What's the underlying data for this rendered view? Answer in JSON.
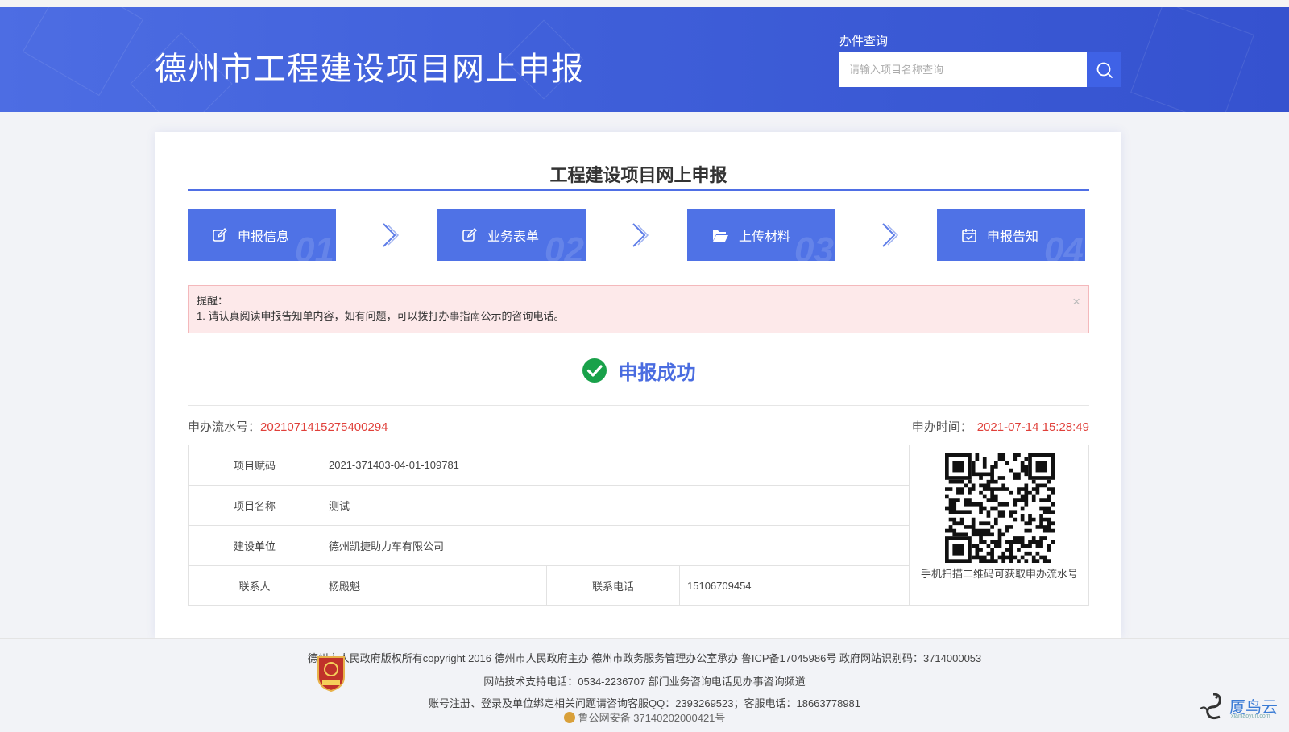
{
  "header": {
    "site_title": "德州市工程建设项目网上申报",
    "search_label": "办件查询",
    "search_placeholder": "请输入项目名称查询"
  },
  "card": {
    "title": "工程建设项目网上申报",
    "steps": [
      {
        "label": "申报信息",
        "num": "01",
        "icon": "edit-icon"
      },
      {
        "label": "业务表单",
        "num": "02",
        "icon": "edit-icon"
      },
      {
        "label": "上传材料",
        "num": "03",
        "icon": "folder-open-icon"
      },
      {
        "label": "申报告知",
        "num": "04",
        "icon": "calendar-check-icon"
      }
    ],
    "alert": {
      "title": "提醒：",
      "message": "1. 请认真阅读申报告知单内容，如有问题，可以拨打办事指南公示的咨询电话。",
      "close": "×"
    },
    "success_text": "申报成功",
    "flow_label": "申办流水号：",
    "flow_value": "2021071415275400294",
    "time_label": "申办时间：",
    "time_value": "2021-07-14 15:28:49",
    "info": {
      "code_label": "项目赋码",
      "code_value": "2021-371403-04-01-109781",
      "name_label": "项目名称",
      "name_value": "测试",
      "unit_label": "建设单位",
      "unit_value": "德州凯捷助力车有限公司",
      "contact_label": "联系人",
      "contact_value": "杨殿魁",
      "phone_label": "联系电话",
      "phone_value": "15106709454",
      "qr_caption": "手机扫描二维码可获取申办流水号"
    }
  },
  "footer": {
    "line1": "德州市人民政府版权所有copyright 2016   德州市人民政府主办 德州市政务服务管理办公室承办 鲁ICP备17045986号   政府网站识别码：3714000053",
    "line2": "网站技术支持电话：0534-2236707    部门业务咨询电话见办事咨询频道",
    "line3": "账号注册、登录及单位绑定相关问题请咨询客服QQ：2393269523；客服电话：18663778981",
    "line4": "鲁公网安备 37140202000421号",
    "brand": "厦鸟云",
    "brand_sub": "xianiaoyun.com"
  },
  "colors": {
    "header_blue": "#4262dc",
    "step_blue": "#4f72e6",
    "accent_red": "#e0403a",
    "success_green": "#19a14a"
  }
}
